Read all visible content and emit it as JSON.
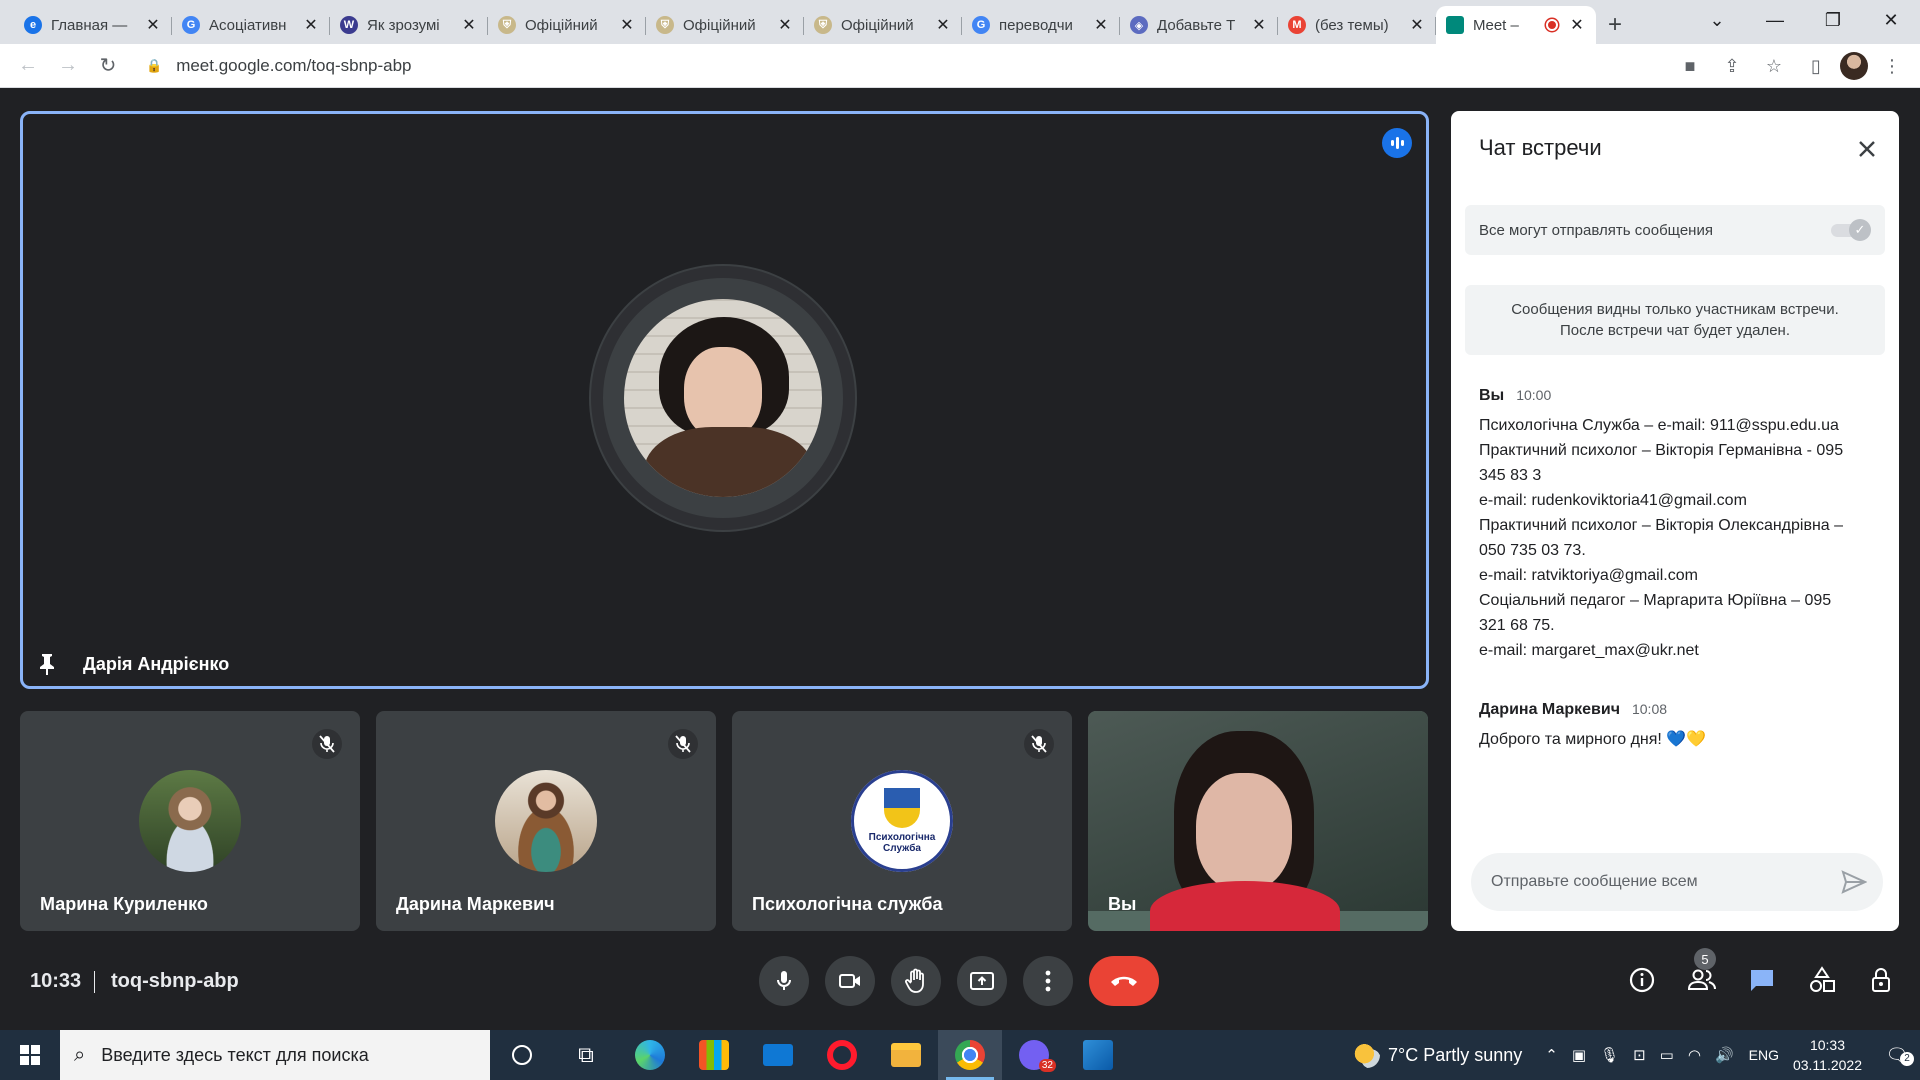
{
  "browser": {
    "tabs": [
      {
        "title": "Главная —",
        "favicon_color": "#1a73e8",
        "favicon_glyph": "e"
      },
      {
        "title": "Асоціативн",
        "favicon_color": "#4285f4",
        "favicon_glyph": "G"
      },
      {
        "title": "Як зрозумі",
        "favicon_color": "#3b3b8f",
        "favicon_glyph": "W"
      },
      {
        "title": "Офіційний",
        "favicon_color": "#c8b88a",
        "favicon_glyph": "⛨"
      },
      {
        "title": "Офіційний",
        "favicon_color": "#c8b88a",
        "favicon_glyph": "⛨"
      },
      {
        "title": "Офіційний",
        "favicon_color": "#c8b88a",
        "favicon_glyph": "⛨"
      },
      {
        "title": "переводчи",
        "favicon_color": "#4285f4",
        "favicon_glyph": "G"
      },
      {
        "title": "Добавьте Т",
        "favicon_color": "#5c6bc0",
        "favicon_glyph": "◈"
      },
      {
        "title": "(без темы)",
        "favicon_color": "#ea4335",
        "favicon_glyph": "M"
      }
    ],
    "active_tab": {
      "title": "Meet –",
      "favicon_color": "#00897b"
    },
    "url": "meet.google.com/toq-sbnp-abp"
  },
  "meeting": {
    "pinned_participant": "Дарія Андрієнко",
    "participants": [
      {
        "name": "Марина Куриленко",
        "muted": true
      },
      {
        "name": "Дарина Маркевич",
        "muted": true
      },
      {
        "name": "Психологічна служба",
        "muted": true,
        "logo_text": "Психологічна Служба"
      },
      {
        "name": "Вы",
        "muted": false
      }
    ],
    "time": "10:33",
    "code": "toq-sbnp-abp",
    "participant_count": "5"
  },
  "chat": {
    "title": "Чат встречи",
    "toggle_label": "Все могут отправлять сообщения",
    "toggle_on": true,
    "notice_line1": "Сообщения видны только участникам встречи.",
    "notice_line2": "После встречи чат будет удален.",
    "messages": [
      {
        "sender": "Вы",
        "time": "10:00",
        "lines": [
          "Психологічна Служба – e-mail: 911@sspu.edu.ua",
          "Практичний психолог – Вікторія Германівна - 095",
          "345 83 3",
          "e-mail: rudenkoviktoria41@gmail.com",
          "Практичний психолог – Вікторія Олександрівна –",
          "050 735 03 73.",
          "e-mail: ratviktoriya@gmail.com",
          "Соціальний педагог – Маргарита Юріївна – 095",
          "321 68 75.",
          "e-mail: margaret_max@ukr.net"
        ]
      },
      {
        "sender": "Дарина Маркевич",
        "time": "10:08",
        "lines": [
          "Доброго та мирного дня!"
        ],
        "hearts": [
          "💙",
          "💛"
        ]
      }
    ],
    "input_placeholder": "Отправьте сообщение всем"
  },
  "taskbar": {
    "search_placeholder": "Введите здесь текст для поиска",
    "viber_badge": "32",
    "weather": "7°C  Partly sunny",
    "lang": "ENG",
    "time": "10:33",
    "date": "03.11.2022",
    "notifications": "2"
  },
  "colors": {
    "accent_blue": "#8ab4f8",
    "end_call_red": "#ea4335",
    "meet_bg": "#202124"
  }
}
